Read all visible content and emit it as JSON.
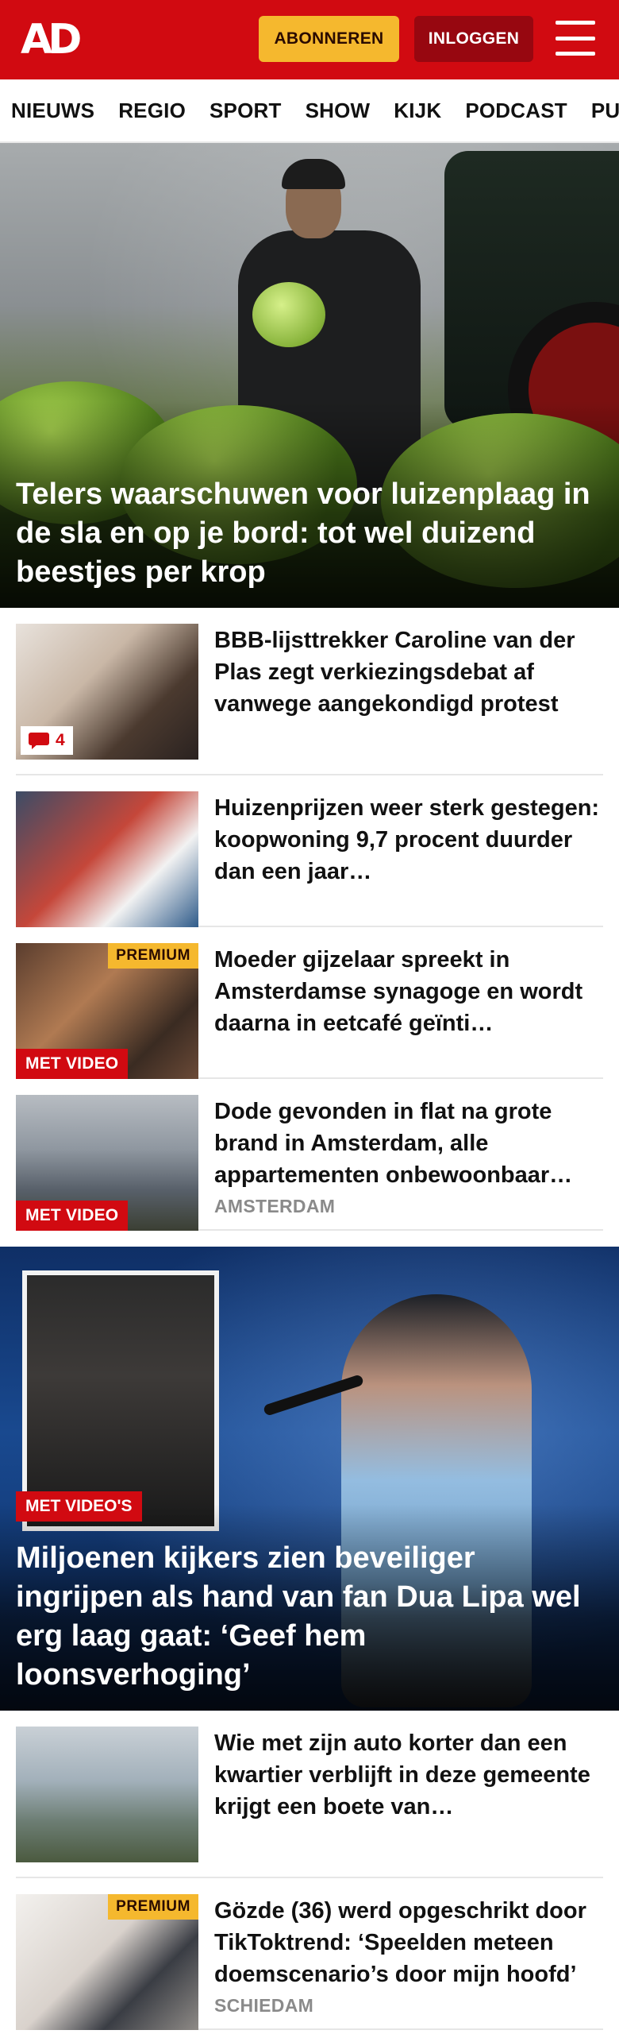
{
  "header": {
    "logo": "AD",
    "subscribe_label": "ABONNEREN",
    "login_label": "INLOGGEN"
  },
  "nav": {
    "items": [
      "NIEUWS",
      "REGIO",
      "SPORT",
      "SHOW",
      "KIJK",
      "PODCAST",
      "PUZZ"
    ]
  },
  "hero1": {
    "title": "Telers waarschuwen voor luizenplaag in de sla en op je bord: tot wel duizend beestjes per krop"
  },
  "articles1": [
    {
      "title": "BBB-lijsttrekker Caroline van der Plas zegt verkiezingsdebat af vanwege aangekondigd protest",
      "comments": "4"
    },
    {
      "title": "Huizenprijzen weer sterk gestegen: koopwoning 9,7 procent duurder dan een jaar…"
    },
    {
      "title": "Moeder gijzelaar spreekt in Amsterdamse synagoge en wordt daarna in eetcafé geïnti…",
      "premium": "PREMIUM",
      "video": "MET VIDEO"
    },
    {
      "title": "Dode gevonden in flat na grote brand in Amsterdam, alle appartementen onbewoonbaar…",
      "video": "MET VIDEO",
      "label": "AMSTERDAM"
    }
  ],
  "hero2": {
    "badge": "MET VIDEO'S",
    "title": "Miljoenen kijkers zien beveiliger ingrijpen als hand van fan Dua Lipa wel erg laag gaat: ‘Geef hem loonsverhoging’"
  },
  "articles2": [
    {
      "title": "Wie met zijn auto korter dan een kwartier verblijft in deze gemeente krijgt een boete van…"
    },
    {
      "title": "Gözde (36) werd opgeschrikt door TikToktrend: ‘Speelden meteen doemscenario’s door mijn hoofd’",
      "premium": "PREMIUM",
      "label": "SCHIEDAM"
    }
  ],
  "colors": {
    "brand_red": "#d10a11",
    "dark_red": "#970710",
    "premium_yellow": "#f5b82e"
  }
}
